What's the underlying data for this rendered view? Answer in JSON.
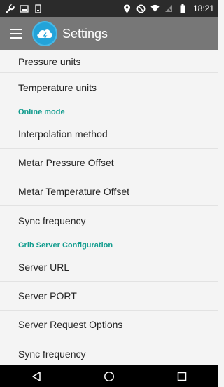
{
  "status_bar": {
    "time": "18:21",
    "icons": [
      "wrench-icon",
      "image-icon",
      "sd-card-icon",
      "location-pin-icon",
      "do-not-disturb-icon",
      "wifi-icon",
      "signal-off-icon",
      "battery-icon"
    ]
  },
  "app_bar": {
    "title": "Settings",
    "menu_icon": "hamburger-menu-icon",
    "logo_icon": "cloud-lightning-logo-icon"
  },
  "settings": {
    "items_top": [
      {
        "label": "Pressure units"
      },
      {
        "label": "Temperature units"
      }
    ],
    "category_online": "Online mode",
    "items_online": [
      {
        "label": "Interpolation method"
      },
      {
        "label": "Metar Pressure Offset"
      },
      {
        "label": "Metar Temperature Offset"
      },
      {
        "label": "Sync frequency"
      }
    ],
    "category_grib": "Grib Server Configuration",
    "items_grib": [
      {
        "label": "Server URL"
      },
      {
        "label": "Server PORT"
      },
      {
        "label": "Server Request Options"
      },
      {
        "label": "Sync frequency"
      }
    ]
  },
  "nav_bar": {
    "buttons": [
      "back-icon",
      "home-icon",
      "recents-icon"
    ]
  },
  "colors": {
    "app_bar": "#777777",
    "status_bar": "#2b2b2b",
    "category_accent": "#129c8e",
    "logo": "#23a3d9",
    "background": "#f4f4f4"
  }
}
